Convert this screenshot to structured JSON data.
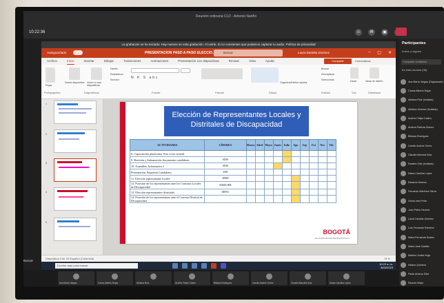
{
  "meeting": {
    "title": "Reunión ordinaria CLD - Antonio Nariño",
    "time": "10:22:36",
    "leave": "Salir"
  },
  "notice": "La grabación se ha iniciado. Hay nuevos en esta grabación. Al unirte, tú no consientes que podamos capturar tu audio. Política de privacidad",
  "ppt": {
    "autosave": "Autoguardado",
    "doc_title": "PRESENTACION PASO A PASO ELECCIO...",
    "search": "Buscar",
    "user": "Laura Daniela Jiménez",
    "win_controls": [
      "–",
      "▢",
      "✕"
    ],
    "menu": [
      "Archivo",
      "Inicio",
      "Insertar",
      "Dibujar",
      "Transiciones",
      "Animaciones",
      "Presentación con diapositivas",
      "Revisar",
      "Vista",
      "Ayuda"
    ],
    "share": "Compartir",
    "comments": "Comentarios",
    "ribbon_groups": [
      "Portapapeles",
      "Diapositivas",
      "Fuente",
      "Párrafo",
      "Dibujo",
      "Edición",
      "Voz",
      "Diseñador"
    ],
    "ribbon_labels": [
      "Pegar",
      "Nueva diapositiva",
      "Volver a usar diapositivas",
      "Diseño",
      "Restablecer",
      "Sección",
      "Organizar",
      "Estilos rápidos",
      "Buscar",
      "Reemplazar",
      "Seleccionar",
      "Dictar",
      "Ideas de diseño"
    ],
    "status_left": "Diapositiva 4 de 24   Español (Colombia)",
    "zoom": "76 %"
  },
  "slide": {
    "title_line1": "Elección de Representantes Locales y",
    "title_line2": "Distritales de Discapacidad",
    "headers": [
      "ACTIVIDADES",
      "LÍDERES",
      "Marzo",
      "Abril",
      "Mayo",
      "Junio",
      "Julio",
      "Ago",
      "Sep",
      "Oct",
      "Nov",
      "Dic"
    ],
    "rows": [
      {
        "act": "8. Capacitación plataforma Voto (voto virtual)",
        "lid": "",
        "marks": [
          0,
          0,
          0,
          0,
          1,
          0,
          0,
          0,
          0,
          0
        ]
      },
      {
        "act": "9. Revisión y Subsanación documentos candidatos",
        "lid": "SDIS",
        "marks": [
          0,
          0,
          0,
          0,
          1,
          0,
          0,
          0,
          0,
          0
        ]
      },
      {
        "act": "10. Asamblea: Informativa 2",
        "lid": "SDIS",
        "marks": [
          0,
          0,
          0,
          1,
          0,
          0,
          0,
          0,
          0,
          0
        ]
      },
      {
        "act": "Presentación Propuesta Candidatos",
        "lid": "SED",
        "marks": [
          0,
          0,
          0,
          0,
          0,
          0,
          0,
          0,
          0,
          0
        ]
      },
      {
        "act": "11. Elección representante locales",
        "lid": "IDRD",
        "marks": [
          0,
          0,
          0,
          0,
          0,
          1,
          0,
          0,
          0,
          0
        ]
      },
      {
        "act": "12. Posesión de los representantes ante los Consejos Locales de Discapacidad",
        "lid": "SDMUJER",
        "marks": [
          0,
          0,
          0,
          0,
          0,
          1,
          0,
          0,
          0,
          0
        ]
      },
      {
        "act": "13. Elección representantes distritales",
        "lid": "IDPAC",
        "marks": [
          0,
          0,
          0,
          0,
          0,
          1,
          0,
          0,
          0,
          0
        ]
      },
      {
        "act": "14. Posesión de los representantes ante el Consejo Distrital de Discapacidad",
        "lid": "",
        "marks": [
          0,
          0,
          0,
          0,
          0,
          1,
          0,
          0,
          0,
          0
        ]
      }
    ],
    "logo": "BOGOTÁ",
    "logo_sub": "ALCALDÍA MAYOR DE BOGOTÁ D.C."
  },
  "sharing": {
    "text": "Estás compartiendo el contenido",
    "stop": "Dejar de compartir",
    "hide": "Ocultar"
  },
  "taskbar": {
    "search": "Escribe aquí para buscar",
    "time": "10:22 a. m.",
    "date": "8/03/2023"
  },
  "panel": {
    "title": "Participantes",
    "subtitle": "Invitar a alguien",
    "search": "Compartir invitación",
    "section": "En esta reunión (36)",
    "people": [
      "Ana María Vargas (Organizador)",
      "Carlos Alberto Rojas",
      "Adriana Ruiz (Invitado)",
      "Adriana Jiménez (Invitado)",
      "Andrés Felipe Castro",
      "Andrea Patricia Gómez",
      "Bibiana Rodríguez",
      "Camilo Andrés Torres",
      "Claudia Marcela Díaz",
      "Daniela Ortiz (Invitado)",
      "Diana Carolina López",
      "Eduardo Moreno",
      "Fernando Martínez Sierra",
      "Gloria Inés Peña",
      "Juan Pablo Herrera",
      "Laura Daniela Jiménez",
      "Luis Fernando Ramírez",
      "María Fernanda Suárez",
      "María José Castillo",
      "Martha Cecilia Vega",
      "Nelson Quintero",
      "Paola Andrea Silva",
      "Ricardo Mejía",
      "Sandra Milena Pardo"
    ]
  },
  "videos": [
    "Ana María Vargas",
    "Carlos Alberto Rojas",
    "Adriana Ruiz",
    "Andrés Felipe Castro",
    "Bibiana Rodríguez",
    "Camilo Andrés Torres",
    "Claudia Marcela Díaz",
    "Diana Carolina López"
  ],
  "outer_label": "Buscar"
}
